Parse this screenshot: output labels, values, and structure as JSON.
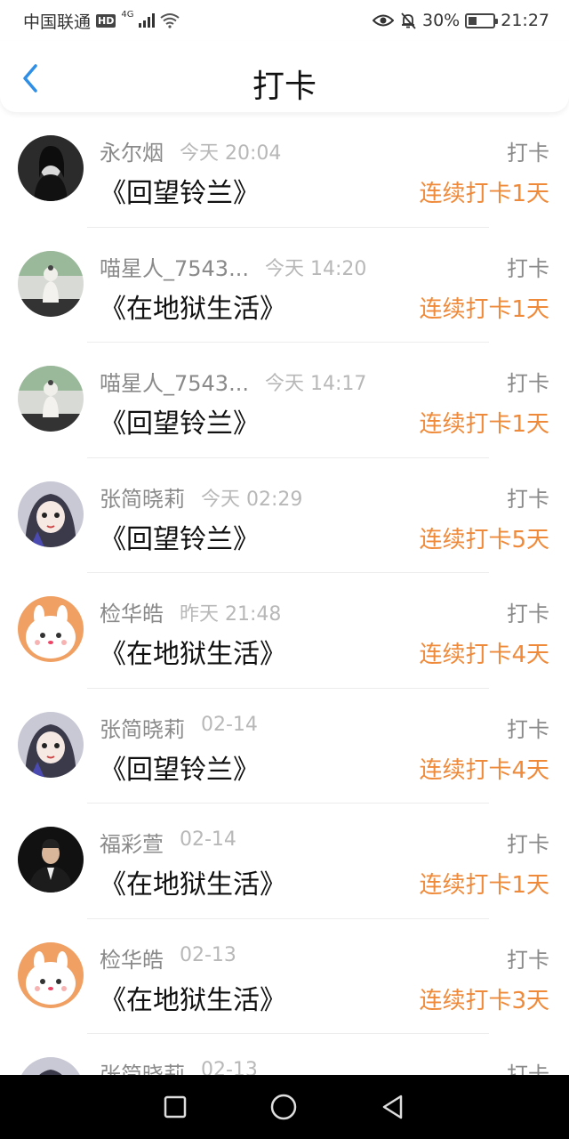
{
  "status_bar": {
    "carrier": "中国联通",
    "hd_badge": "HD",
    "network": "4G",
    "battery_percent": "30%",
    "time": "21:27"
  },
  "header": {
    "title": "打卡"
  },
  "rows": [
    {
      "username": "永尔烟",
      "time": "今天 20:04",
      "book": "《回望铃兰》",
      "action": "打卡",
      "streak": "连续打卡1天",
      "avatar": "dark-portrait"
    },
    {
      "username": "喵星人_7543...",
      "time": "今天 14:20",
      "book": "《在地狱生活》",
      "action": "打卡",
      "streak": "连续打卡1天",
      "avatar": "figurine"
    },
    {
      "username": "喵星人_7543...",
      "time": "今天 14:17",
      "book": "《回望铃兰》",
      "action": "打卡",
      "streak": "连续打卡1天",
      "avatar": "figurine"
    },
    {
      "username": "张简晓莉",
      "time": "今天 02:29",
      "book": "《回望铃兰》",
      "action": "打卡",
      "streak": "连续打卡5天",
      "avatar": "anime-girl"
    },
    {
      "username": "检华皓",
      "time": "昨天 21:48",
      "book": "《在地狱生活》",
      "action": "打卡",
      "streak": "连续打卡4天",
      "avatar": "cartoon-bunny"
    },
    {
      "username": "张简晓莉",
      "time": "02-14",
      "book": "《回望铃兰》",
      "action": "打卡",
      "streak": "连续打卡4天",
      "avatar": "anime-girl"
    },
    {
      "username": "福彩萱",
      "time": "02-14",
      "book": "《在地狱生活》",
      "action": "打卡",
      "streak": "连续打卡1天",
      "avatar": "man-in-suit"
    },
    {
      "username": "检华皓",
      "time": "02-13",
      "book": "《在地狱生活》",
      "action": "打卡",
      "streak": "连续打卡3天",
      "avatar": "cartoon-bunny"
    },
    {
      "username": "张简晓莉",
      "time": "02-13",
      "book": "",
      "action": "打卡",
      "streak": "",
      "avatar": "anime-girl"
    }
  ],
  "colors": {
    "accent_back": "#2f8fe6",
    "streak": "#ef8a3a",
    "muted_text": "#8a8a8a",
    "time_text": "#b8b8b8"
  },
  "icons": {
    "nav_recent": "square-icon",
    "nav_home": "circle-icon",
    "nav_back": "triangle-back-icon",
    "header_back": "chevron-left-icon"
  }
}
